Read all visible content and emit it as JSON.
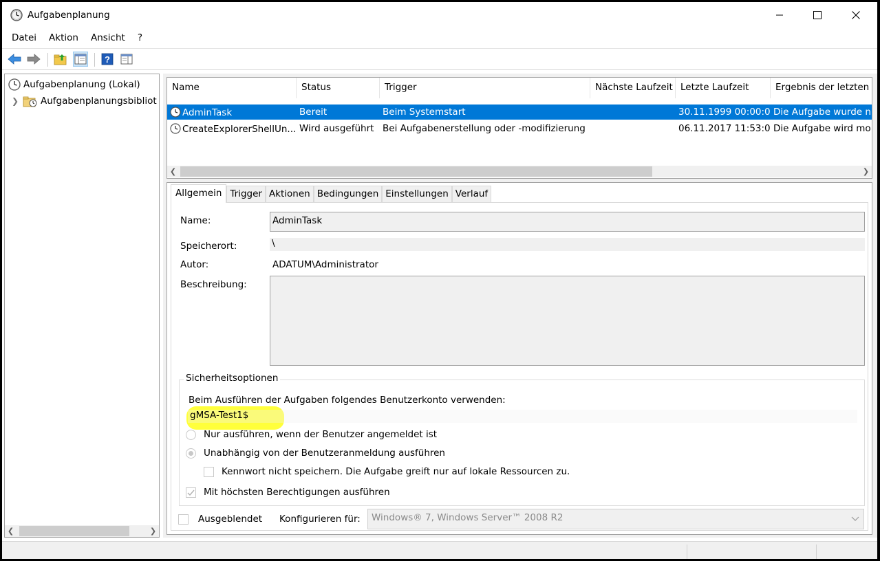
{
  "window": {
    "title": "Aufgabenplanung"
  },
  "menu": [
    "Datei",
    "Aktion",
    "Ansicht",
    "?"
  ],
  "tree": {
    "root": "Aufgabenplanung (Lokal)",
    "child": "Aufgabenplanungsbibliot"
  },
  "list": {
    "columns": [
      "Name",
      "Status",
      "Trigger",
      "Nächste Laufzeit",
      "Letzte Laufzeit",
      "Ergebnis der letzten A"
    ],
    "rows": [
      {
        "name": "AdminTask",
        "status": "Bereit",
        "trigger": "Beim Systemstart",
        "next": "",
        "last": "30.11.1999 00:00:00",
        "result": "Die Aufgabe wurde n"
      },
      {
        "name": "CreateExplorerShellUn...",
        "status": "Wird ausgeführt",
        "trigger": "Bei Aufgabenerstellung oder -modifizierung",
        "next": "",
        "last": "06.11.2017 11:53:06",
        "result": "Die Aufgabe wird mo"
      }
    ]
  },
  "tabs": [
    "Allgemein",
    "Trigger",
    "Aktionen",
    "Bedingungen",
    "Einstellungen",
    "Verlauf"
  ],
  "general": {
    "name_label": "Name:",
    "name_value": "AdminTask",
    "location_label": "Speicherort:",
    "location_value": "\\",
    "author_label": "Autor:",
    "author_value": "ADATUM\\Administrator",
    "description_label": "Beschreibung:",
    "description_value": ""
  },
  "security": {
    "title": "Sicherheitsoptionen",
    "account_prompt": "Beim Ausführen der Aufgaben folgendes Benutzerkonto verwenden:",
    "account_value": "gMSA-Test1$",
    "highlight_color": "#ffff2a",
    "radio_logged_on": "Nur ausführen, wenn der Benutzer angemeldet ist",
    "radio_independent": "Unabhängig von der Benutzeranmeldung ausführen",
    "no_store_password": "Kennwort nicht speichern. Die Aufgabe greift nur auf lokale Ressourcen zu.",
    "highest_privileges": "Mit höchsten Berechtigungen ausführen"
  },
  "footer": {
    "hidden_label": "Ausgeblendet",
    "configure_label": "Konfigurieren für:",
    "configure_value": "Windows® 7, Windows Server™ 2008 R2"
  },
  "colors": {
    "selection": "#0078d7",
    "accent_icon": "#1e73be"
  }
}
